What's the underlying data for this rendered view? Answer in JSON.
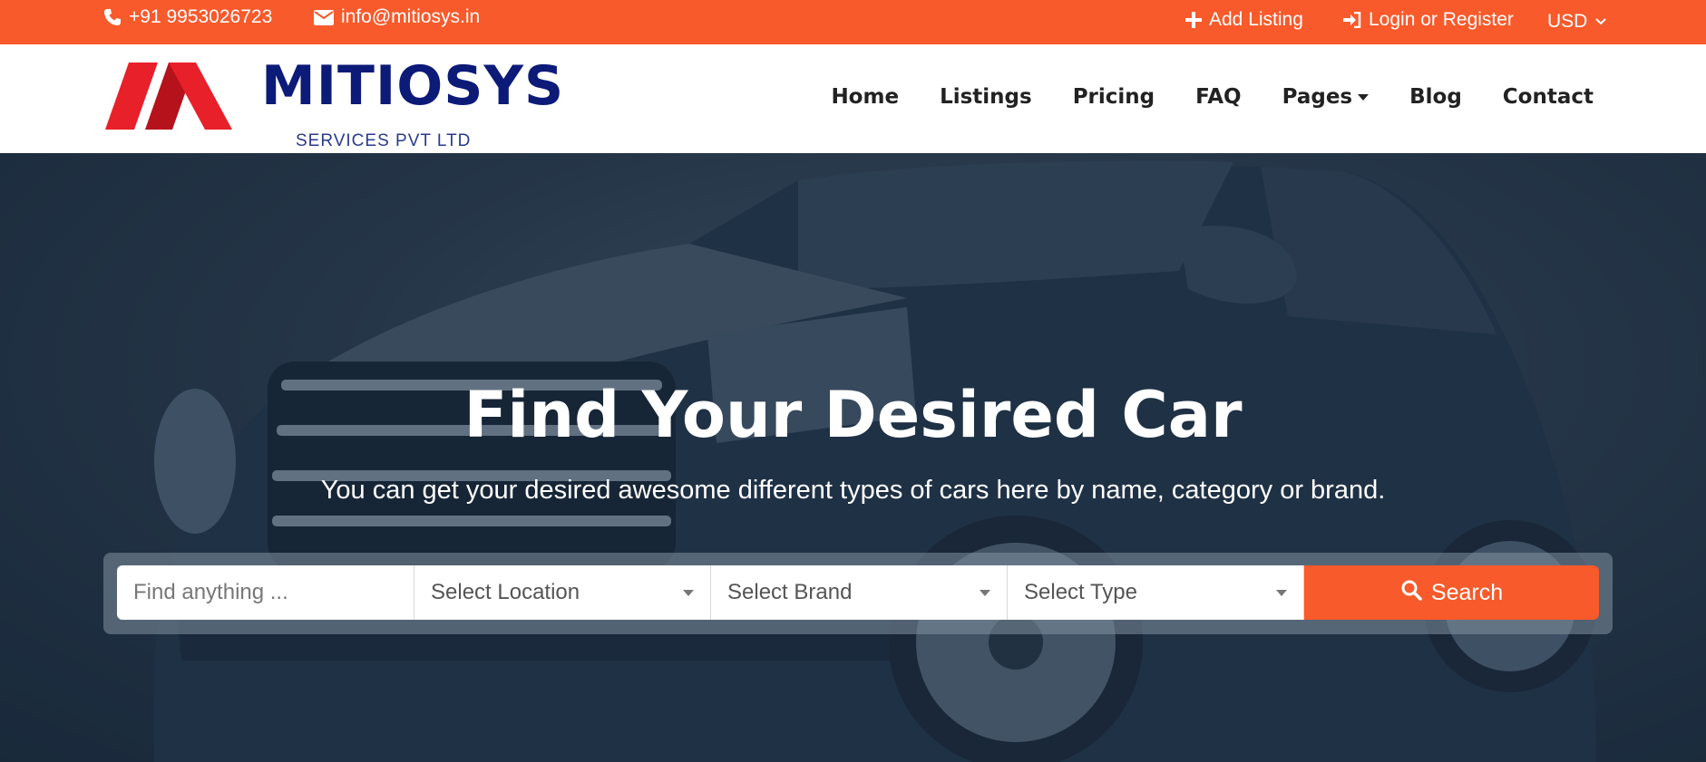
{
  "colors": {
    "accent": "#f85a2b",
    "brand_navy": "#0c1a78",
    "brand_red": "#e8202a"
  },
  "topbar": {
    "phone": "+91 9953026723",
    "email": "info@mitiosys.in",
    "add_listing": "Add Listing",
    "login": "Login or Register",
    "currency": "USD"
  },
  "brand": {
    "name": "MITIOSYS",
    "tagline": "SERVICES PVT LTD"
  },
  "nav": {
    "items": [
      "Home",
      "Listings",
      "Pricing",
      "FAQ",
      "Pages",
      "Blog",
      "Contact"
    ]
  },
  "hero": {
    "title": "Find Your Desired Car",
    "subtitle": "You can get your desired awesome different types of cars here by name, category or brand."
  },
  "search": {
    "keyword_placeholder": "Find anything ...",
    "location": "Select Location",
    "brand": "Select Brand",
    "type": "Select Type",
    "button": "Search"
  },
  "icons": [
    "phone-icon",
    "envelope-icon",
    "plus-icon",
    "sign-in-icon",
    "chevron-down-icon",
    "search-icon",
    "caret-down-icon"
  ]
}
